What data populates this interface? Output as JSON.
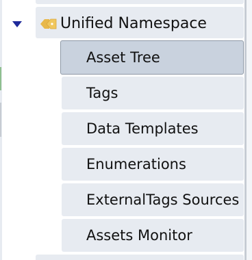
{
  "tree": {
    "parent": {
      "label": "Unified Namespace",
      "icon": "tag-pair-icon",
      "expanded": true
    },
    "children": [
      {
        "label": "Asset Tree",
        "selected": true
      },
      {
        "label": "Tags",
        "selected": false
      },
      {
        "label": "Data Templates",
        "selected": false
      },
      {
        "label": "Enumerations",
        "selected": false
      },
      {
        "label": "ExternalTags Sources",
        "selected": false
      },
      {
        "label": "Assets Monitor",
        "selected": false
      }
    ]
  },
  "colors": {
    "item_bg": "#e7ebf1",
    "selected_bg": "#c9d2de",
    "arrow": "#1f2a9a",
    "icon": "#e8b84a"
  }
}
